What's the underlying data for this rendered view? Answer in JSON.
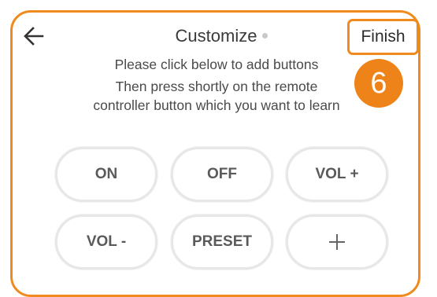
{
  "header": {
    "back_icon": "arrow-left-icon",
    "title": "Customize",
    "finish_label": "Finish"
  },
  "step_badge": "6",
  "instructions": {
    "line1": "Please click below to add buttons",
    "line2": "Then press shortly on the remote controller button which you want to learn"
  },
  "buttons": [
    {
      "label": "ON"
    },
    {
      "label": "OFF"
    },
    {
      "label": "VOL +"
    },
    {
      "label": "VOL -"
    },
    {
      "label": "PRESET"
    },
    {
      "label": "+",
      "icon": "plus-icon"
    }
  ],
  "colors": {
    "accent": "#f08a1c",
    "badge": "#ee8319",
    "button_border": "#e7e7e7",
    "text": "#4a4a4a"
  }
}
